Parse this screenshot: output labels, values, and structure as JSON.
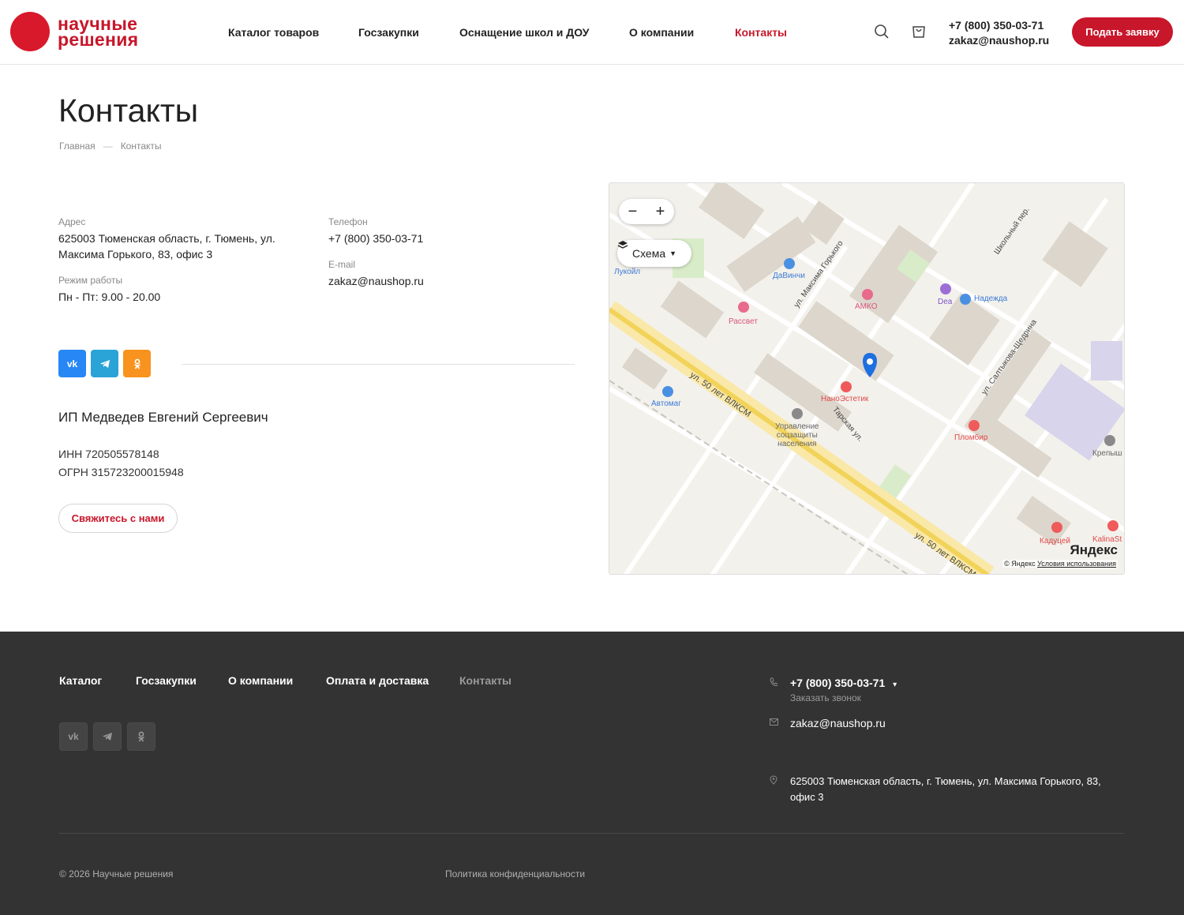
{
  "header": {
    "logo_line1": "научные",
    "logo_line2": "решения",
    "nav": [
      "Каталог товаров",
      "Госзакупки",
      "Оснащение школ и ДОУ",
      "О компании",
      "Контакты"
    ],
    "phone": "+7 (800) 350-03-71",
    "email": "zakaz@naushop.ru",
    "cta": "Подать заявку",
    "icons": [
      "search-icon",
      "cart-icon"
    ]
  },
  "main": {
    "title": "Контакты",
    "breadcrumb": [
      "Главная",
      "—",
      "Контакты"
    ],
    "address_label": "Адрес",
    "address_line1": "625003 Тюменская область, г. Тюмень, ул.",
    "address_line2": "Максима Горького, 83, офис 3",
    "hours_label": "Режим работы",
    "hours": "Пн - Пт: 9.00 - 20.00",
    "phone_label": "Телефон",
    "phone": "+7 (800) 350-03-71",
    "email_label": "E-mail",
    "email": "zakaz@naushop.ru",
    "social": [
      "vk",
      "telegram",
      "ok"
    ],
    "company": "ИП Медведев Евгений Сергеевич",
    "inn": "ИНН 720505578148",
    "ogrn": "ОГРН 315723200015948",
    "contact_button": "Свяжитесь с нами"
  },
  "map": {
    "zoom_out": "−",
    "zoom_in": "+",
    "layer": "Схема",
    "labels": {
      "davinchi": "ДаВинчи",
      "rassvet": "Рассвет",
      "amko": "АМКО",
      "dea": "Dea",
      "nadezhda": "Надежда",
      "nanoestetik": "НаноЭстетик",
      "avtomag": "Автомаг",
      "uszn1": "Управление",
      "uszn2": "соцзащиты",
      "uszn3": "населения",
      "plombir": "Пломбир",
      "kaduceus": "Кадуцей",
      "kalina": "KalinaSt",
      "krepysh": "Крепыш",
      "lukoil": "Лукойл",
      "street1": "ул. 50 лет ВЛКСМ",
      "street2": "ул. Максима Горького",
      "street3": "ул. Салтыкова-Щедрина",
      "street4": "Тарская ул.",
      "street5": "Школьный пер.",
      "street6": "ул. 50 лет ВЛКСМ"
    },
    "yandex": "Яндекс",
    "copyright": "© Яндекс",
    "terms": "Условия использования"
  },
  "footer": {
    "nav": [
      "Каталог",
      "Госзакупки",
      "О компании",
      "Оплата и доставка",
      "Контакты"
    ],
    "phone": "+7 (800) 350-03-71",
    "phone_arrow": "▾",
    "callback": "Заказать звонок",
    "email": "zakaz@naushop.ru",
    "address": "625003 Тюменская область, г. Тюмень, ул. Максима Горького, 83, офис 3",
    "copyright": "© 2026 Научные решения",
    "policy": "Политика конфиденциальности"
  },
  "colors": {
    "brand": "#c8162a",
    "footer_bg": "#333333",
    "vk": "#2787f5",
    "telegram": "#2aa3d6",
    "ok": "#f7931e"
  }
}
